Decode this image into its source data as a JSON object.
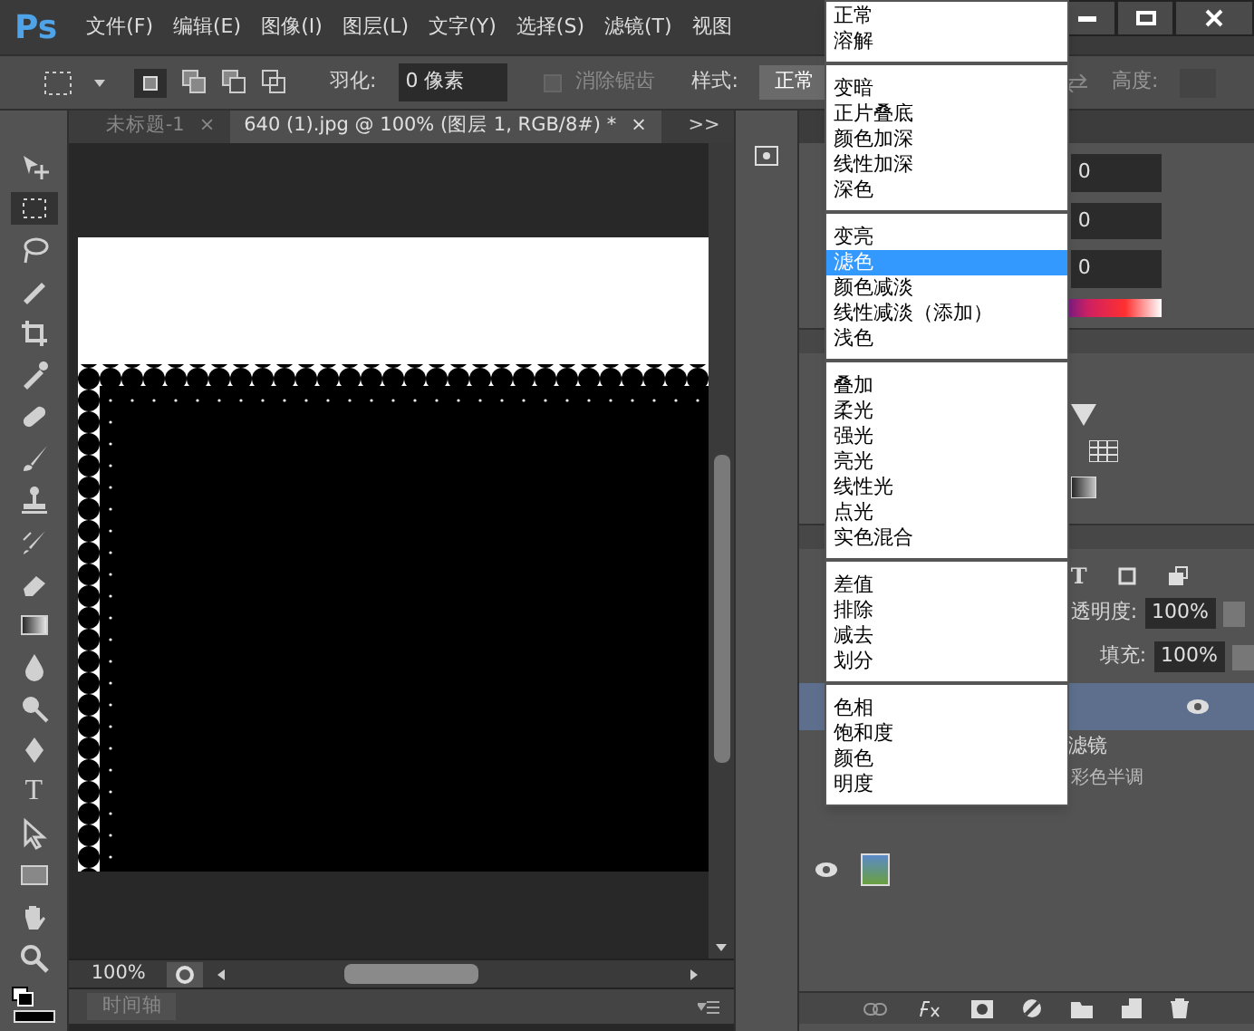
{
  "app": {
    "logo": "Ps"
  },
  "menu_bar": [
    "文件(F)",
    "编辑(E)",
    "图像(I)",
    "图层(L)",
    "文字(Y)",
    "选择(S)",
    "滤镜(T)",
    "视图"
  ],
  "options_bar": {
    "feather_label": "羽化:",
    "feather_value": "0 像素",
    "antialias": {
      "label": "消除锯齿",
      "checked": false
    },
    "style_label": "样式:",
    "style_value": "正常",
    "height_label": "高度:"
  },
  "tools": [
    {
      "kind": "move",
      "selected": false
    },
    {
      "kind": "marquee",
      "selected": true
    },
    {
      "kind": "lasso",
      "selected": false
    },
    {
      "kind": "quick",
      "selected": false
    },
    {
      "kind": "crop",
      "selected": false
    },
    {
      "kind": "eyedropper",
      "selected": false
    },
    {
      "kind": "heal",
      "selected": false
    },
    {
      "kind": "brush",
      "selected": false
    },
    {
      "kind": "stamp",
      "selected": false
    },
    {
      "kind": "history",
      "selected": false
    },
    {
      "kind": "eraser",
      "selected": false
    },
    {
      "kind": "gradient",
      "selected": false
    },
    {
      "kind": "blur",
      "selected": false
    },
    {
      "kind": "dodge",
      "selected": false
    },
    {
      "kind": "pen",
      "selected": false
    },
    {
      "kind": "type",
      "label": "T",
      "selected": false
    },
    {
      "kind": "path",
      "selected": false
    },
    {
      "kind": "shape",
      "selected": false
    },
    {
      "kind": "hand",
      "selected": false
    },
    {
      "kind": "zoom",
      "selected": false
    }
  ],
  "document_tabs": [
    {
      "label": "未标题-1",
      "close": "×",
      "selected": false
    },
    {
      "label": "640 (1).jpg @ 100% (图层 1, RGB/8#) *",
      "close": "×",
      "selected": true
    }
  ],
  "tab_overflow": ">>",
  "status_bar": {
    "zoom": "100%"
  },
  "timeline": {
    "label": "时间轴"
  },
  "properties": {
    "values": [
      "0",
      "0",
      "0"
    ]
  },
  "layers": {
    "type_filter": "T",
    "opacity_label": "透明度:",
    "opacity_value": "100%",
    "fill_label": "填充:",
    "fill_value": "100%",
    "rows": [
      {
        "kind": "layer",
        "selected": true
      },
      {
        "kind": "text",
        "label": "滤镜"
      },
      {
        "kind": "filter",
        "label": "彩色半调"
      },
      {
        "kind": "layer",
        "selected": false
      }
    ]
  },
  "blend_menu": [
    [
      {
        "label": "正常",
        "selected": false
      },
      {
        "label": "溶解",
        "selected": false
      }
    ],
    [
      {
        "label": "变暗",
        "selected": false
      },
      {
        "label": "正片叠底",
        "selected": false
      },
      {
        "label": "颜色加深",
        "selected": false
      },
      {
        "label": "线性加深",
        "selected": false
      },
      {
        "label": "深色",
        "selected": false
      }
    ],
    [
      {
        "label": "变亮",
        "selected": false
      },
      {
        "label": "滤色",
        "selected": true
      },
      {
        "label": "颜色减淡",
        "selected": false
      },
      {
        "label": "线性减淡（添加）",
        "selected": false
      },
      {
        "label": "浅色",
        "selected": false
      }
    ],
    [
      {
        "label": "叠加",
        "selected": false
      },
      {
        "label": "柔光",
        "selected": false
      },
      {
        "label": "强光",
        "selected": false
      },
      {
        "label": "亮光",
        "selected": false
      },
      {
        "label": "线性光",
        "selected": false
      },
      {
        "label": "点光",
        "selected": false
      },
      {
        "label": "实色混合",
        "selected": false
      }
    ],
    [
      {
        "label": "差值",
        "selected": false
      },
      {
        "label": "排除",
        "selected": false
      },
      {
        "label": "减去",
        "selected": false
      },
      {
        "label": "划分",
        "selected": false
      }
    ],
    [
      {
        "label": "色相",
        "selected": false
      },
      {
        "label": "饱和度",
        "selected": false
      },
      {
        "label": "颜色",
        "selected": false
      },
      {
        "label": "明度",
        "selected": false
      }
    ]
  ]
}
